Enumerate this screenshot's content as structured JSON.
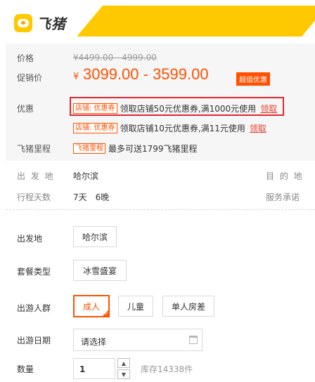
{
  "brand": {
    "name": "飞猪",
    "logo_icon": "fliggy-pig-logo",
    "accent": "#ffc900"
  },
  "price": {
    "label": "价格",
    "original": "¥4499.00 - 4999.00",
    "promo_label": "促销价",
    "currency": "¥",
    "promo_value": "3099.00 - 3599.00",
    "badge": "超值优惠",
    "color": "#ff5000"
  },
  "offers": {
    "label": "优惠",
    "items": [
      {
        "tag": "店铺: 优惠券",
        "text": "领取店铺50元优惠券,满1000元使用",
        "link": "领取"
      },
      {
        "tag": "店铺: 优惠券",
        "text": "领取店铺10元优惠券,满11元使用",
        "link": "领取"
      }
    ]
  },
  "mileage": {
    "label": "飞猪里程",
    "tag": "飞猪里程",
    "text": "最多可送1799飞猪里程"
  },
  "trip": {
    "departure_label": "出 发 地",
    "departure_value": "哈尔滨",
    "destination_label": "目 的 地",
    "days_label": "行程天数",
    "days_value": "7天　6晚",
    "service_label": "服务承诺"
  },
  "options": {
    "departure": {
      "label": "出发地",
      "choices": [
        "哈尔滨"
      ]
    },
    "package": {
      "label": "套餐类型",
      "choices": [
        "冰雪盛宴"
      ]
    },
    "travelers": {
      "label": "出游人群",
      "choices": [
        "成人",
        "儿童",
        "单人房差"
      ],
      "selected": "成人"
    },
    "date": {
      "label": "出游日期",
      "placeholder": "请选择"
    },
    "quantity": {
      "label": "数量",
      "value": "1",
      "stock": "库存14338件"
    }
  }
}
